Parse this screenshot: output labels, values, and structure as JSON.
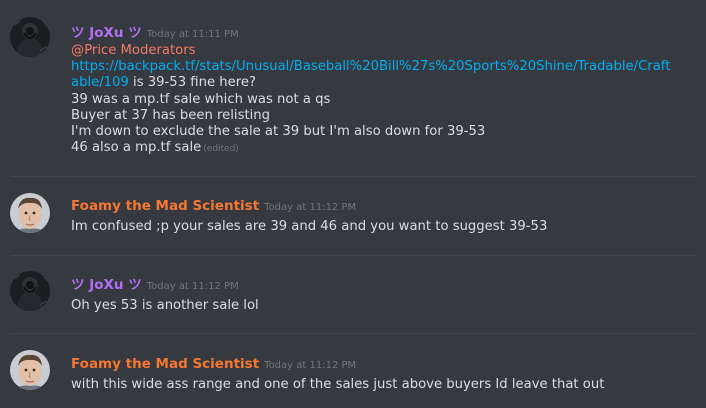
{
  "theme": {
    "background": "#36393f",
    "divider": "#42454a",
    "text": "#dcddde",
    "timestamp": "#72767d",
    "link": "#00b0f4",
    "mention": "#f47b67"
  },
  "messages": [
    {
      "author": "ツ JoXu ツ",
      "author_color": "#b16ff3",
      "avatar": "dark-hooded-avatar",
      "timestamp": "Today at 11:11 PM",
      "mention": "@Price Moderators",
      "link_line1": "https://backpack.tf/stats/Unusual/Baseball%20Bill%27s%20Sports%20Shine/Tradable/Craft",
      "link_line2": "able/109",
      "after_link": " is 39-53 fine here?",
      "lines": [
        "39 was a mp.tf sale which was not a qs",
        "Buyer at 37 has been relisting",
        "I'm down to exclude the sale at 39 but I'm also down for 39-53"
      ],
      "last_line": "46 also a mp.tf sale",
      "edited": "(edited)"
    },
    {
      "author": "Foamy the Mad Scientist",
      "author_color": "#f57731",
      "avatar": "man-face-avatar",
      "timestamp": "Today at 11:12 PM",
      "text": "Im confused ;p your sales are 39 and 46 and you want to suggest 39-53"
    },
    {
      "author": "ツ JoXu ツ",
      "author_color": "#b16ff3",
      "avatar": "dark-hooded-avatar",
      "timestamp": "Today at 11:12 PM",
      "text": "Oh yes 53 is another sale lol"
    },
    {
      "author": "Foamy the Mad Scientist",
      "author_color": "#f57731",
      "avatar": "man-face-avatar",
      "timestamp": "Today at 11:12 PM",
      "text": "with this wide ass range and one of the sales just above buyers Id leave that out"
    }
  ]
}
